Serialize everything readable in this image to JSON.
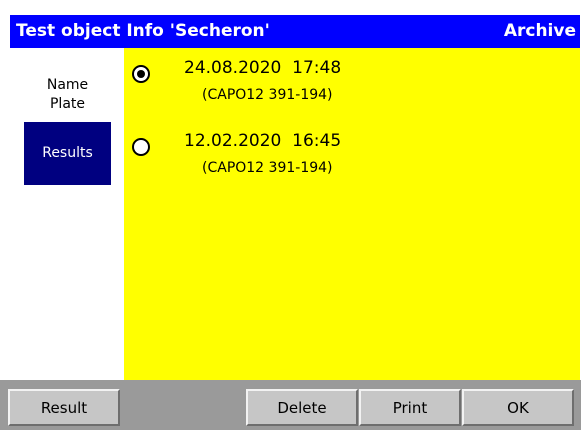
{
  "header": {
    "title": "Test object Info 'Secheron'",
    "mode": "Archive"
  },
  "sidebar": {
    "items": [
      {
        "label_line1": "Name",
        "label_line2": "Plate",
        "selected": false
      },
      {
        "label": "Results",
        "selected": true
      }
    ]
  },
  "results": [
    {
      "datetime": "24.08.2020  17:48",
      "device": "(CAPO12 391-194)",
      "selected": true
    },
    {
      "datetime": "12.02.2020  16:45",
      "device": "(CAPO12 391-194)",
      "selected": false
    }
  ],
  "toolbar": {
    "result_label": "Result",
    "delete_label": "Delete",
    "print_label": "Print",
    "ok_label": "OK"
  },
  "colors": {
    "title_bar": "#0000ff",
    "content_bg": "#ffff00",
    "selected_nav": "#000080",
    "toolbar_bg": "#9a9a9a",
    "button_face": "#c6c6c6"
  }
}
